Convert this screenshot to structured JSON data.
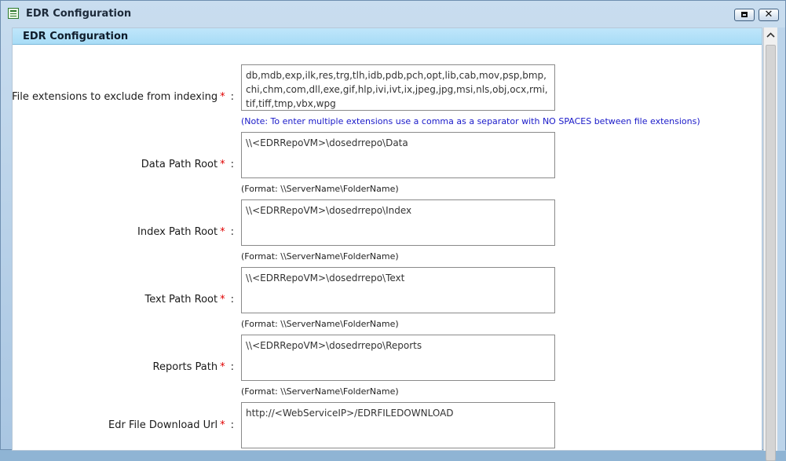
{
  "window": {
    "title": "EDR Configuration"
  },
  "section": {
    "title": "EDR Configuration"
  },
  "fields": {
    "exclude": {
      "label": "File extensions to exclude from indexing",
      "required": "*",
      "colon": ":",
      "value": "db,mdb,exp,ilk,res,trg,tlh,idb,pdb,pch,opt,lib,cab,mov,psp,bmp,chi,chm,com,dll,exe,gif,hlp,ivi,ivt,ix,jpeg,jpg,msi,nls,obj,ocx,rmi,tif,tiff,tmp,vbx,wpg",
      "note": "(Note: To enter multiple extensions use a comma as a separator with NO SPACES between file extensions)"
    },
    "data_path": {
      "label": "Data Path Root",
      "required": "*",
      "colon": ":",
      "value": "\\\\<EDRRepoVM>\\dosedrrepo\\Data",
      "hint": "(Format: \\\\ServerName\\FolderName)"
    },
    "index_path": {
      "label": "Index Path Root",
      "required": "*",
      "colon": ":",
      "value": "\\\\<EDRRepoVM>\\dosedrrepo\\Index",
      "hint": "(Format: \\\\ServerName\\FolderName)"
    },
    "text_path": {
      "label": "Text Path Root",
      "required": "*",
      "colon": ":",
      "value": "\\\\<EDRRepoVM>\\dosedrrepo\\Text",
      "hint": "(Format: \\\\ServerName\\FolderName)"
    },
    "reports_path": {
      "label": "Reports Path",
      "required": "*",
      "colon": ":",
      "value": "\\\\<EDRRepoVM>\\dosedrrepo\\Reports",
      "hint": "(Format: \\\\ServerName\\FolderName)"
    },
    "download_url": {
      "label": "Edr File Download Url",
      "required": "*",
      "colon": ":",
      "value": "http://<WebServiceIP>/EDRFILEDOWNLOAD"
    }
  },
  "icons": {
    "app": "window-icon",
    "maximize": "maximize-icon",
    "close": "close-icon",
    "scroll_up": "chevron-up-icon"
  },
  "colors": {
    "required": "#e00000",
    "note": "#1a1ac9",
    "section_header": "#a8dcf6"
  }
}
